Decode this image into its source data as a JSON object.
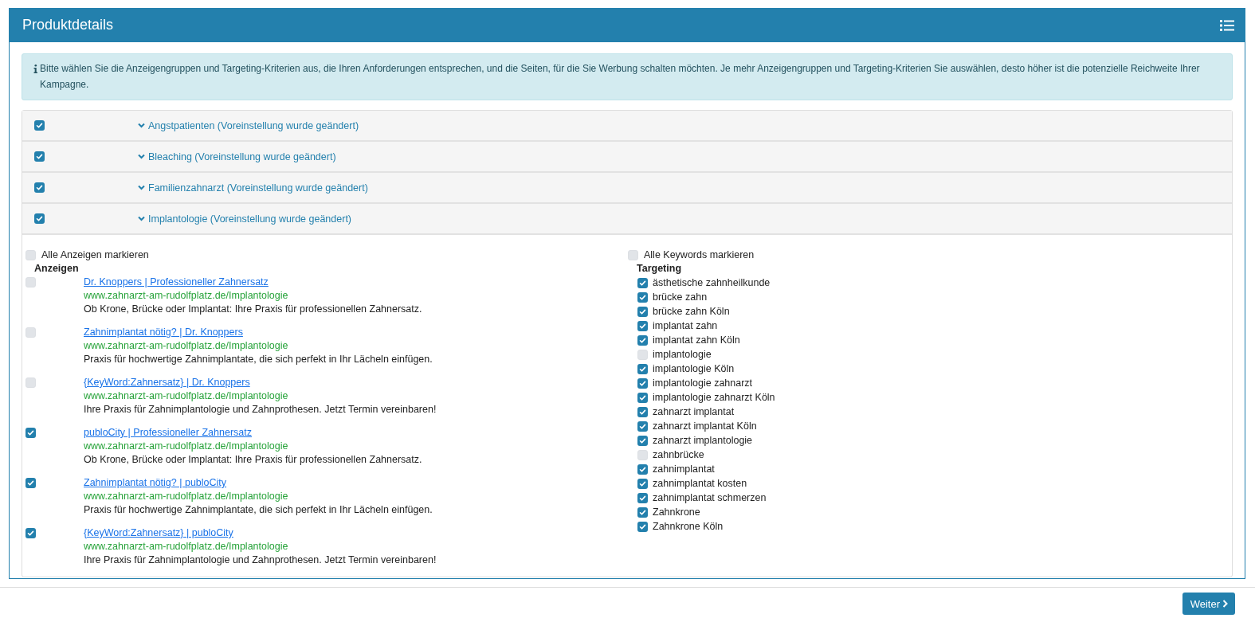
{
  "panel": {
    "title": "Produktdetails"
  },
  "info": {
    "text": "Bitte wählen Sie die Anzeigengruppen und Targeting-Kriterien aus, die Ihren Anforderungen entsprechen, und die Seiten, für die Sie Werbung schalten möchten. Je mehr Anzeigengruppen und Targeting-Kriterien Sie auswählen, desto höher ist die potenzielle Reichweite Ihrer Kampagne."
  },
  "groups": [
    {
      "label": "Angstpatienten (Voreinstellung wurde geändert)",
      "checked": true
    },
    {
      "label": "Bleaching (Voreinstellung wurde geändert)",
      "checked": true
    },
    {
      "label": "Familienzahnarzt (Voreinstellung wurde geändert)",
      "checked": true
    },
    {
      "label": "Implantologie (Voreinstellung wurde geändert)",
      "checked": true,
      "ads_section": {
        "select_all": {
          "label": "Alle Anzeigen markieren",
          "checked": false
        },
        "heading": "Anzeigen",
        "ads": [
          {
            "checked": false,
            "title": "Dr. Knoppers | Professioneller Zahnersatz",
            "url": "www.zahnarzt-am-rudolfplatz.de/Implantologie",
            "description": "Ob Krone, Brücke oder Implantat: Ihre Praxis für professionellen Zahnersatz."
          },
          {
            "checked": false,
            "title": "Zahnimplantat nötig? | Dr. Knoppers",
            "url": "www.zahnarzt-am-rudolfplatz.de/Implantologie",
            "description": "Praxis für hochwertige Zahnimplantate, die sich perfekt in Ihr Lächeln einfügen."
          },
          {
            "checked": false,
            "title": "{KeyWord:Zahnersatz} | Dr. Knoppers",
            "url": "www.zahnarzt-am-rudolfplatz.de/Implantologie",
            "description": "Ihre Praxis für Zahnimplantologie und Zahnprothesen. Jetzt Termin vereinbaren!"
          },
          {
            "checked": true,
            "title": "publoCity | Professioneller Zahnersatz",
            "url": "www.zahnarzt-am-rudolfplatz.de/Implantologie",
            "description": "Ob Krone, Brücke oder Implantat: Ihre Praxis für professionellen Zahnersatz."
          },
          {
            "checked": true,
            "title": "Zahnimplantat nötig? | publoCity",
            "url": "www.zahnarzt-am-rudolfplatz.de/Implantologie",
            "description": "Praxis für hochwertige Zahnimplantate, die sich perfekt in Ihr Lächeln einfügen."
          },
          {
            "checked": true,
            "title": "{KeyWord:Zahnersatz} | publoCity",
            "url": "www.zahnarzt-am-rudolfplatz.de/Implantologie",
            "description": "Ihre Praxis für Zahnimplantologie und Zahnprothesen. Jetzt Termin vereinbaren!"
          }
        ]
      },
      "targeting_section": {
        "select_all": {
          "label": "Alle Keywords markieren",
          "checked": false
        },
        "heading": "Targeting",
        "keywords": [
          {
            "label": "ästhetische zahnheilkunde",
            "checked": true
          },
          {
            "label": "brücke zahn",
            "checked": true
          },
          {
            "label": "brücke zahn Köln",
            "checked": true
          },
          {
            "label": "implantat zahn",
            "checked": true
          },
          {
            "label": "implantat zahn Köln",
            "checked": true
          },
          {
            "label": "implantologie",
            "checked": false
          },
          {
            "label": "implantologie Köln",
            "checked": true
          },
          {
            "label": "implantologie zahnarzt",
            "checked": true
          },
          {
            "label": "implantologie zahnarzt Köln",
            "checked": true
          },
          {
            "label": "zahnarzt implantat",
            "checked": true
          },
          {
            "label": "zahnarzt implantat Köln",
            "checked": true
          },
          {
            "label": "zahnarzt implantologie",
            "checked": true
          },
          {
            "label": "zahnbrücke",
            "checked": false
          },
          {
            "label": "zahnimplantat",
            "checked": true
          },
          {
            "label": "zahnimplantat kosten",
            "checked": true
          },
          {
            "label": "zahnimplantat schmerzen",
            "checked": true
          },
          {
            "label": "Zahnkrone",
            "checked": true
          },
          {
            "label": "Zahnkrone Köln",
            "checked": true
          }
        ]
      }
    }
  ],
  "footer": {
    "button": "Weiter"
  }
}
